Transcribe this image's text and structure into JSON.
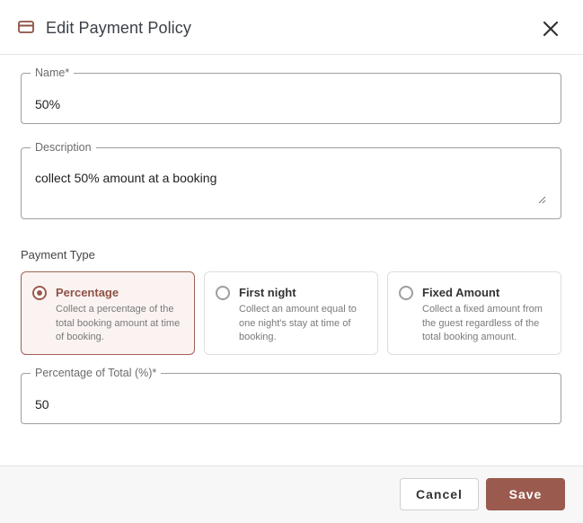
{
  "dialog": {
    "title": "Edit Payment Policy",
    "title_icon": "credit-card-icon",
    "close_icon": "close-icon"
  },
  "form": {
    "name": {
      "label": "Name*",
      "value": "50%"
    },
    "description": {
      "label": "Description",
      "value": "collect 50% amount at a booking"
    },
    "payment_type": {
      "label": "Payment Type",
      "selected": "Percentage",
      "options": [
        {
          "title": "Percentage",
          "description": "Collect a percentage of the total booking amount at time of booking.",
          "selected": true
        },
        {
          "title": "First night",
          "description": "Collect an amount equal to one night's stay at time of booking.",
          "selected": false
        },
        {
          "title": "Fixed Amount",
          "description": "Collect a fixed amount from the guest regardless of the total booking amount.",
          "selected": false
        }
      ]
    },
    "percentage": {
      "label": "Percentage of Total (%)*",
      "value": "50"
    }
  },
  "footer": {
    "cancel_label": "Cancel",
    "save_label": "Save"
  },
  "colors": {
    "accent": "#9a5b4e",
    "selected_background": "#faf3f1"
  }
}
